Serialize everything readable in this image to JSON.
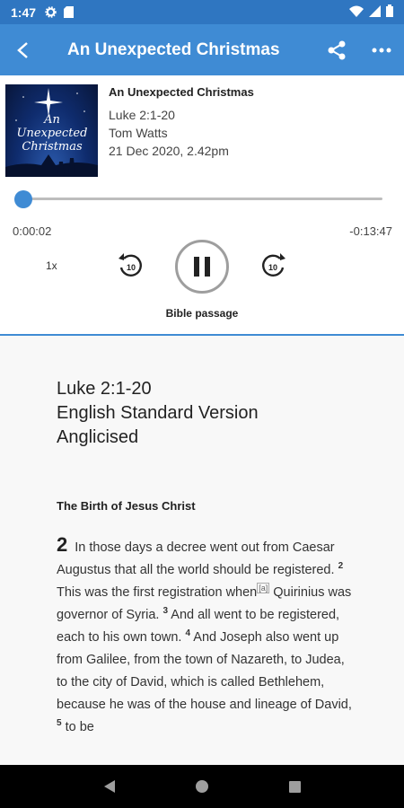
{
  "status_bar": {
    "time": "1:47",
    "icons": [
      "gear-icon",
      "sd-card-icon",
      "wifi-icon",
      "signal-icon",
      "battery-icon"
    ]
  },
  "app_bar": {
    "title": "An Unexpected Christmas",
    "color": "#3f8bd4",
    "icons": [
      "back-arrow-icon",
      "share-icon",
      "more-vert-icon"
    ]
  },
  "episode": {
    "artwork_text": "An Unexpected Christmas",
    "title": "An Unexpected Christmas",
    "passage": "Luke 2:1-20",
    "speaker": "Tom Watts",
    "date": "21 Dec 2020, 2.42pm"
  },
  "player": {
    "progress": 0.0025,
    "elapsed": "0:00:02",
    "remaining": "-0:13:47",
    "speed": "1x",
    "rewind_label": "10",
    "forward_label": "10",
    "bible_button": "Bible passage"
  },
  "bible": {
    "reference": "Luke 2:1-20",
    "version_line1": "English Standard Version",
    "version_line2": "Anglicised",
    "section_heading": "The Birth of Jesus Christ",
    "chapter": "2",
    "verse1": "In those days a decree went out from Caesar Augustus that all the world should be registered.",
    "v2_num": "2",
    "verse2_a": "This was the first registration when",
    "footnote": "[a]",
    "verse2_b": "Quirinius was governor of Syria.",
    "v3_num": "3",
    "verse3": "And all went to be registered, each to his own town.",
    "v4_num": "4",
    "verse4": "And Joseph also went up from Galilee, from the town of Nazareth, to Judea, to the city of David, which is called Bethlehem, because he was of the house and lineage of David,",
    "v5_num": "5",
    "verse5": "to be"
  },
  "nav_bar": {
    "icons": [
      "back-triangle-icon",
      "home-circle-icon",
      "recents-square-icon"
    ]
  }
}
